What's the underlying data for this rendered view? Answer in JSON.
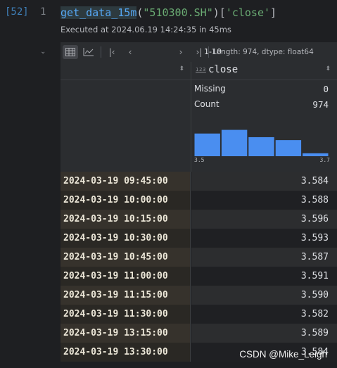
{
  "cell": {
    "prompt": "[52]",
    "line_number": "1",
    "code_fn": "get_data_15m",
    "code_open": "(",
    "code_arg": "\"510300.SH\"",
    "code_close": ")[",
    "code_key": "'close'",
    "code_end": "]",
    "execution_info": "Executed at 2024.06.19 14:24:35 in 45ms"
  },
  "toolbar": {
    "page_range": "1-10",
    "meta": "Length: 974, dtype: float64",
    "icons": [
      "table-view-icon",
      "chart-view-icon",
      "first-page-icon",
      "prev-page-icon",
      "next-page-icon",
      "last-page-icon"
    ]
  },
  "column": {
    "type_badge": "123",
    "name": "close",
    "missing_label": "Missing",
    "missing_value": "0",
    "count_label": "Count",
    "count_value": "974",
    "hist_min": "3.5",
    "hist_max": "3.7"
  },
  "chart_data": {
    "type": "bar",
    "xlim": [
      3.5,
      3.7
    ],
    "values": [
      0.62,
      0.72,
      0.52,
      0.44,
      0.08
    ],
    "widths": [
      0.2,
      0.2,
      0.2,
      0.2,
      0.2
    ],
    "color": "#4a8ef0"
  },
  "rows": [
    {
      "index": "2024-03-19 09:45:00",
      "value": "3.584"
    },
    {
      "index": "2024-03-19 10:00:00",
      "value": "3.588"
    },
    {
      "index": "2024-03-19 10:15:00",
      "value": "3.596"
    },
    {
      "index": "2024-03-19 10:30:00",
      "value": "3.593"
    },
    {
      "index": "2024-03-19 10:45:00",
      "value": "3.587"
    },
    {
      "index": "2024-03-19 11:00:00",
      "value": "3.591"
    },
    {
      "index": "2024-03-19 11:15:00",
      "value": "3.590"
    },
    {
      "index": "2024-03-19 11:30:00",
      "value": "3.582"
    },
    {
      "index": "2024-03-19 13:15:00",
      "value": "3.589"
    },
    {
      "index": "2024-03-19 13:30:00",
      "value": "3.584"
    }
  ],
  "watermark": "CSDN @Mike_Leigh"
}
